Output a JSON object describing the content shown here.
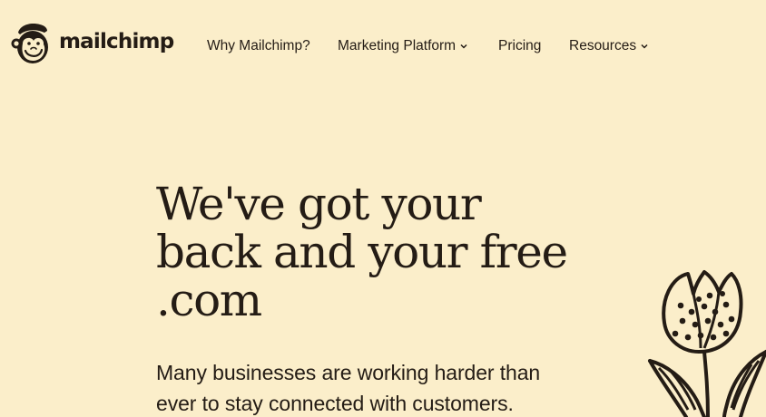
{
  "brand": {
    "name": "mailchimp",
    "logo_icon": "freddie-chimp-icon"
  },
  "nav": {
    "items": [
      {
        "label": "Why Mailchimp?",
        "has_dropdown": false
      },
      {
        "label": "Marketing Platform",
        "has_dropdown": true,
        "icon": "chevron-down-icon"
      },
      {
        "label": "Pricing",
        "has_dropdown": false
      },
      {
        "label": "Resources",
        "has_dropdown": true,
        "icon": "chevron-down-icon"
      }
    ]
  },
  "hero": {
    "title_lines": [
      "We've got your",
      "back and your free",
      ".com"
    ],
    "subtitle_lines": [
      "Many businesses are working harder than",
      "ever to stay connected with customers."
    ]
  },
  "decoration": {
    "illustration": "tulip-flower-illustration"
  },
  "colors": {
    "background": "#fbeeca",
    "text": "#241c15"
  }
}
